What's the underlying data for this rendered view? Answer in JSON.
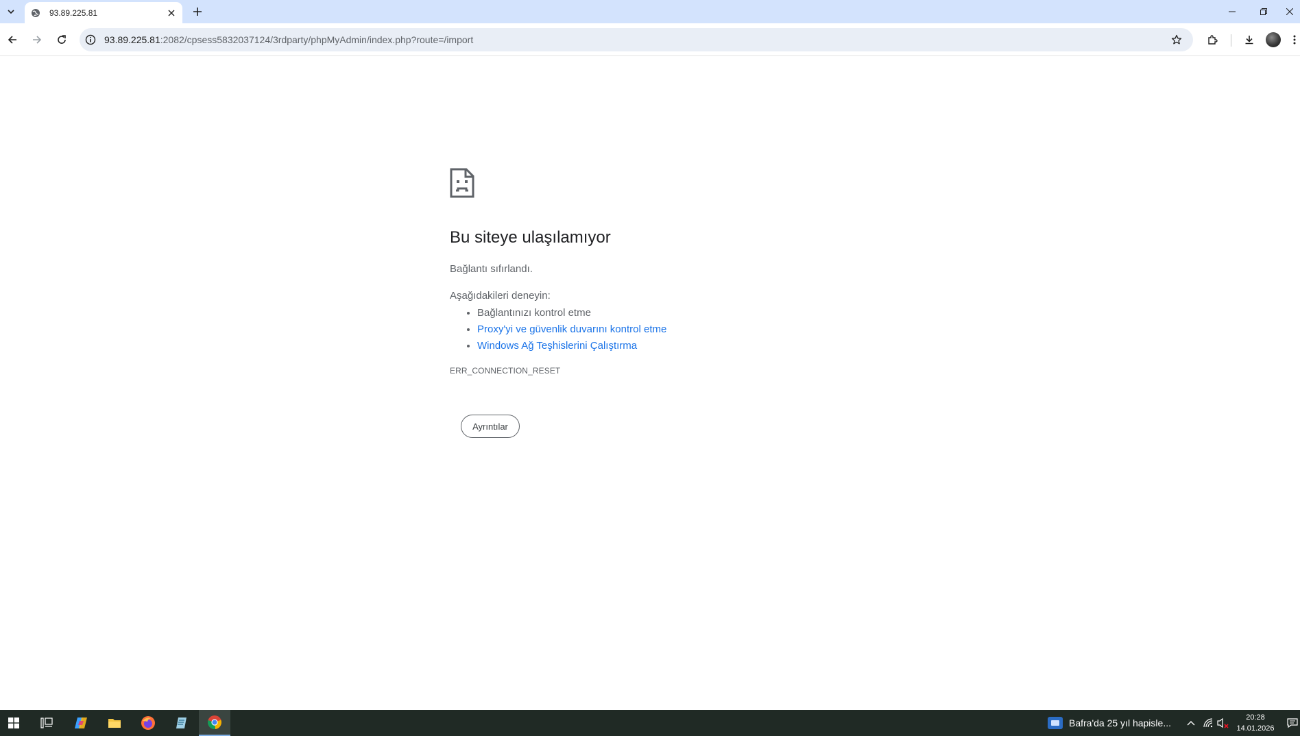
{
  "tab": {
    "title": "93.89.225.81"
  },
  "omnibox": {
    "url_host": "93.89.225.81",
    "url_rest": ":2082/cpsess5832037124/3rdparty/phpMyAdmin/index.php?route=/import"
  },
  "error": {
    "title": "Bu siteye ulaşılamıyor",
    "description": "Bağlantı sıfırlandı.",
    "try_heading": "Aşağıdakileri deneyin:",
    "suggestions": [
      "Bağlantınızı kontrol etme",
      "Proxy'yi ve güvenlik duvarını kontrol etme",
      "Windows Ağ Teşhislerini Çalıştırma"
    ],
    "code": "ERR_CONNECTION_RESET",
    "details_label": "Ayrıntılar"
  },
  "taskbar": {
    "news_text": "Bafra'da 25 yıl hapisle...",
    "time": "20:28",
    "date": "14.01.2026"
  },
  "colors": {
    "tabstrip": "#d3e3fd",
    "link": "#1a73e8",
    "taskbar": "#202a25"
  },
  "icons": [
    "tab-search-icon",
    "globe-icon",
    "close-icon",
    "plus-icon",
    "minimize-icon",
    "restore-icon",
    "back-icon",
    "forward-icon",
    "reload-icon",
    "info-icon",
    "star-icon",
    "extensions-icon",
    "download-icon",
    "more-icon",
    "sad-page-icon",
    "windows-start-icon",
    "task-view-icon",
    "copilot-icon",
    "file-explorer-icon",
    "firefox-icon",
    "notepad-icon",
    "chrome-icon",
    "chevron-up-icon",
    "wifi-icon",
    "volume-muted-icon",
    "notification-icon"
  ]
}
